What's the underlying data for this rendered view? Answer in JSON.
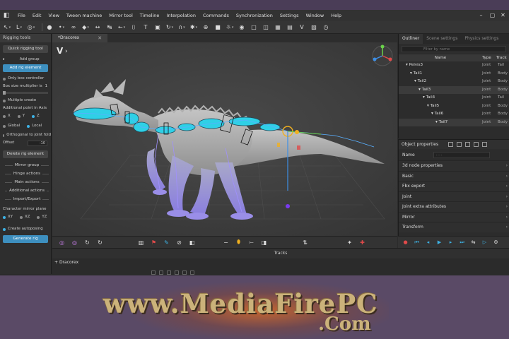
{
  "menubar": {
    "items": [
      "File",
      "Edit",
      "View",
      "Tween machine",
      "Mirror tool",
      "Timeline",
      "Interpolation",
      "Commands",
      "Synchronization",
      "Settings",
      "Window",
      "Help"
    ]
  },
  "left_panel": {
    "title": "Rigging tools",
    "quick_button": "Quick rigging tool",
    "add_group": "Add group",
    "add_rig_element": "Add rig element",
    "only_box_controller": "Only box controller",
    "box_size_label": "Box size multiplier is",
    "box_size_value": "1",
    "multiple_create": "Multiple create",
    "additional_point_label": "Additional point in Axis",
    "axes": [
      "X",
      "Y",
      "Z"
    ],
    "global": "Global",
    "local": "Local",
    "orthogonal": "Orthogonal to joint fold",
    "offset_label": "Offset",
    "offset_value": "-10",
    "delete_rig_element": "Delete rig element",
    "sections": [
      "Mirror group",
      "Hinge actions",
      "Main actions",
      "Additional actions",
      "Import/Export"
    ],
    "mirror_plane_label": "Character mirror plane",
    "planes": [
      "XY",
      "XZ",
      "YZ"
    ],
    "create_autoposing": "Create autoposing",
    "generate_rig": "Generate rig"
  },
  "viewport": {
    "tab_label": "*Dracorex"
  },
  "outliner": {
    "tabs": [
      "Outliner",
      "Scene settings",
      "Physics settings"
    ],
    "filter_placeholder": "Filter by name",
    "columns": [
      "Name",
      "Type",
      "Track"
    ],
    "rows": [
      {
        "name": "Pelvis3",
        "type": "Joint",
        "track": "Tail"
      },
      {
        "name": "Tail1",
        "type": "Joint",
        "track": "Body"
      },
      {
        "name": "Tail2",
        "type": "Joint",
        "track": "Body"
      },
      {
        "name": "Tail3",
        "type": "Joint",
        "track": "Body"
      },
      {
        "name": "Tail4",
        "type": "Joint",
        "track": "Tail"
      },
      {
        "name": "Tail5",
        "type": "Joint",
        "track": "Body"
      },
      {
        "name": "Tail6",
        "type": "Joint",
        "track": "Body"
      },
      {
        "name": "Tail7",
        "type": "Joint",
        "track": "Body"
      }
    ]
  },
  "object_properties": {
    "title": "Object properties",
    "name_label": "Name",
    "name_value": "- - -",
    "sections": [
      "3d node properties",
      "Basic",
      "Fbx export",
      "Joint",
      "Joint extra attributes",
      "Mirror",
      "Transform"
    ]
  },
  "tracks": {
    "title": "Tracks",
    "rows": [
      "Dracorex"
    ]
  },
  "watermark": {
    "line1": "www.MediaFirePC",
    "line2": ".Com"
  },
  "colors": {
    "accent": "#3db3e6",
    "bone": "#2fd0e6",
    "selection": "#f0b020"
  }
}
